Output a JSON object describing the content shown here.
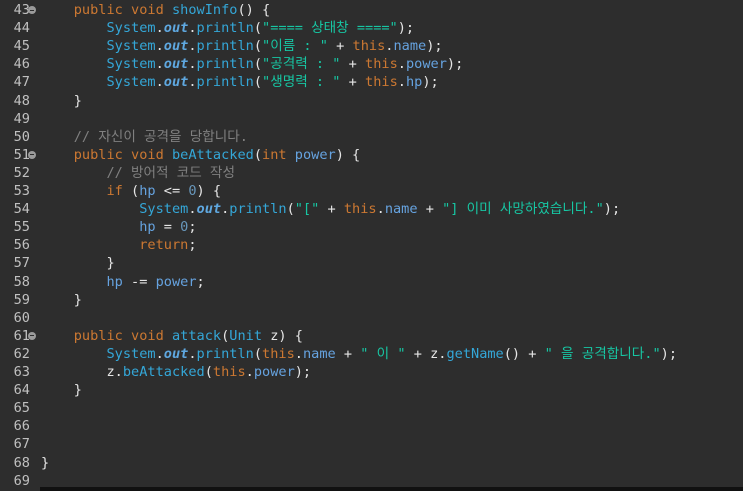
{
  "editor": {
    "lines": [
      {
        "n": "43",
        "fold": true,
        "tokens": [
          {
            "t": "    "
          },
          {
            "t": "public",
            "c": "kw"
          },
          {
            "t": " "
          },
          {
            "t": "void",
            "c": "kw"
          },
          {
            "t": " "
          },
          {
            "t": "showInfo",
            "c": "meth"
          },
          {
            "t": "() {"
          }
        ]
      },
      {
        "n": "44",
        "tokens": [
          {
            "t": "        "
          },
          {
            "t": "System",
            "c": "sys"
          },
          {
            "t": "."
          },
          {
            "t": "out",
            "c": "out"
          },
          {
            "t": "."
          },
          {
            "t": "println",
            "c": "meth"
          },
          {
            "t": "("
          },
          {
            "t": "\"==== 상태창 ====\"",
            "c": "str"
          },
          {
            "t": ");"
          }
        ]
      },
      {
        "n": "45",
        "tokens": [
          {
            "t": "        "
          },
          {
            "t": "System",
            "c": "sys"
          },
          {
            "t": "."
          },
          {
            "t": "out",
            "c": "out"
          },
          {
            "t": "."
          },
          {
            "t": "println",
            "c": "meth"
          },
          {
            "t": "("
          },
          {
            "t": "\"이름 : \"",
            "c": "str"
          },
          {
            "t": " + "
          },
          {
            "t": "this",
            "c": "kw"
          },
          {
            "t": "."
          },
          {
            "t": "name",
            "c": "fld"
          },
          {
            "t": ");"
          }
        ]
      },
      {
        "n": "46",
        "tokens": [
          {
            "t": "        "
          },
          {
            "t": "System",
            "c": "sys"
          },
          {
            "t": "."
          },
          {
            "t": "out",
            "c": "out"
          },
          {
            "t": "."
          },
          {
            "t": "println",
            "c": "meth"
          },
          {
            "t": "("
          },
          {
            "t": "\"공격력 : \"",
            "c": "str"
          },
          {
            "t": " + "
          },
          {
            "t": "this",
            "c": "kw"
          },
          {
            "t": "."
          },
          {
            "t": "power",
            "c": "fld"
          },
          {
            "t": ");"
          }
        ]
      },
      {
        "n": "47",
        "tokens": [
          {
            "t": "        "
          },
          {
            "t": "System",
            "c": "sys"
          },
          {
            "t": "."
          },
          {
            "t": "out",
            "c": "out"
          },
          {
            "t": "."
          },
          {
            "t": "println",
            "c": "meth"
          },
          {
            "t": "("
          },
          {
            "t": "\"생명력 : \"",
            "c": "str"
          },
          {
            "t": " + "
          },
          {
            "t": "this",
            "c": "kw"
          },
          {
            "t": "."
          },
          {
            "t": "hp",
            "c": "fld"
          },
          {
            "t": ");"
          }
        ]
      },
      {
        "n": "48",
        "tokens": [
          {
            "t": "    }"
          }
        ]
      },
      {
        "n": "49",
        "tokens": []
      },
      {
        "n": "50",
        "tokens": [
          {
            "t": "    "
          },
          {
            "t": "// 자신이 공격을 당합니다.",
            "c": "cmt"
          }
        ]
      },
      {
        "n": "51",
        "fold": true,
        "tokens": [
          {
            "t": "    "
          },
          {
            "t": "public",
            "c": "kw"
          },
          {
            "t": " "
          },
          {
            "t": "void",
            "c": "kw"
          },
          {
            "t": " "
          },
          {
            "t": "beAttacked",
            "c": "meth"
          },
          {
            "t": "("
          },
          {
            "t": "int",
            "c": "kw"
          },
          {
            "t": " "
          },
          {
            "t": "power",
            "c": "fld"
          },
          {
            "t": ") {"
          }
        ]
      },
      {
        "n": "52",
        "tokens": [
          {
            "t": "        "
          },
          {
            "t": "// 방어적 코드 작성",
            "c": "cmt"
          }
        ]
      },
      {
        "n": "53",
        "tokens": [
          {
            "t": "        "
          },
          {
            "t": "if",
            "c": "kw"
          },
          {
            "t": " ("
          },
          {
            "t": "hp",
            "c": "fld"
          },
          {
            "t": " <= "
          },
          {
            "t": "0",
            "c": "num"
          },
          {
            "t": ") {"
          }
        ]
      },
      {
        "n": "54",
        "tokens": [
          {
            "t": "            "
          },
          {
            "t": "System",
            "c": "sys"
          },
          {
            "t": "."
          },
          {
            "t": "out",
            "c": "out"
          },
          {
            "t": "."
          },
          {
            "t": "println",
            "c": "meth"
          },
          {
            "t": "("
          },
          {
            "t": "\"[\"",
            "c": "str"
          },
          {
            "t": " + "
          },
          {
            "t": "this",
            "c": "kw"
          },
          {
            "t": "."
          },
          {
            "t": "name",
            "c": "fld"
          },
          {
            "t": " + "
          },
          {
            "t": "\"] 이미 사망하였습니다.\"",
            "c": "str"
          },
          {
            "t": ");"
          }
        ]
      },
      {
        "n": "55",
        "tokens": [
          {
            "t": "            "
          },
          {
            "t": "hp",
            "c": "fld"
          },
          {
            "t": " = "
          },
          {
            "t": "0",
            "c": "num"
          },
          {
            "t": ";"
          }
        ]
      },
      {
        "n": "56",
        "tokens": [
          {
            "t": "            "
          },
          {
            "t": "return",
            "c": "kw"
          },
          {
            "t": ";"
          }
        ]
      },
      {
        "n": "57",
        "tokens": [
          {
            "t": "        }"
          }
        ]
      },
      {
        "n": "58",
        "tokens": [
          {
            "t": "        "
          },
          {
            "t": "hp",
            "c": "fld"
          },
          {
            "t": " -= "
          },
          {
            "t": "power",
            "c": "fld"
          },
          {
            "t": ";"
          }
        ]
      },
      {
        "n": "59",
        "tokens": [
          {
            "t": "    }"
          }
        ]
      },
      {
        "n": "60",
        "tokens": []
      },
      {
        "n": "61",
        "fold": true,
        "tokens": [
          {
            "t": "    "
          },
          {
            "t": "public",
            "c": "kw"
          },
          {
            "t": " "
          },
          {
            "t": "void",
            "c": "kw"
          },
          {
            "t": " "
          },
          {
            "t": "attack",
            "c": "meth"
          },
          {
            "t": "("
          },
          {
            "t": "Unit",
            "c": "typ"
          },
          {
            "t": " "
          },
          {
            "t": "z",
            "c": "plain"
          },
          {
            "t": ") {"
          }
        ]
      },
      {
        "n": "62",
        "tokens": [
          {
            "t": "        "
          },
          {
            "t": "System",
            "c": "sys"
          },
          {
            "t": "."
          },
          {
            "t": "out",
            "c": "out"
          },
          {
            "t": "."
          },
          {
            "t": "println",
            "c": "meth"
          },
          {
            "t": "("
          },
          {
            "t": "this",
            "c": "kw"
          },
          {
            "t": "."
          },
          {
            "t": "name",
            "c": "fld"
          },
          {
            "t": " + "
          },
          {
            "t": "\" 이 \"",
            "c": "str"
          },
          {
            "t": " + "
          },
          {
            "t": "z",
            "c": "plain"
          },
          {
            "t": "."
          },
          {
            "t": "getName",
            "c": "meth"
          },
          {
            "t": "() + "
          },
          {
            "t": "\" 을 공격합니다.\"",
            "c": "str"
          },
          {
            "t": ");"
          }
        ]
      },
      {
        "n": "63",
        "tokens": [
          {
            "t": "        "
          },
          {
            "t": "z",
            "c": "plain"
          },
          {
            "t": "."
          },
          {
            "t": "beAttacked",
            "c": "meth"
          },
          {
            "t": "("
          },
          {
            "t": "this",
            "c": "kw"
          },
          {
            "t": "."
          },
          {
            "t": "power",
            "c": "fld"
          },
          {
            "t": ");"
          }
        ]
      },
      {
        "n": "64",
        "tokens": [
          {
            "t": "    }"
          }
        ]
      },
      {
        "n": "65",
        "tokens": []
      },
      {
        "n": "66",
        "tokens": []
      },
      {
        "n": "67",
        "tokens": []
      },
      {
        "n": "68",
        "tokens": [
          {
            "t": "}"
          }
        ]
      },
      {
        "n": "69",
        "tokens": []
      }
    ]
  }
}
